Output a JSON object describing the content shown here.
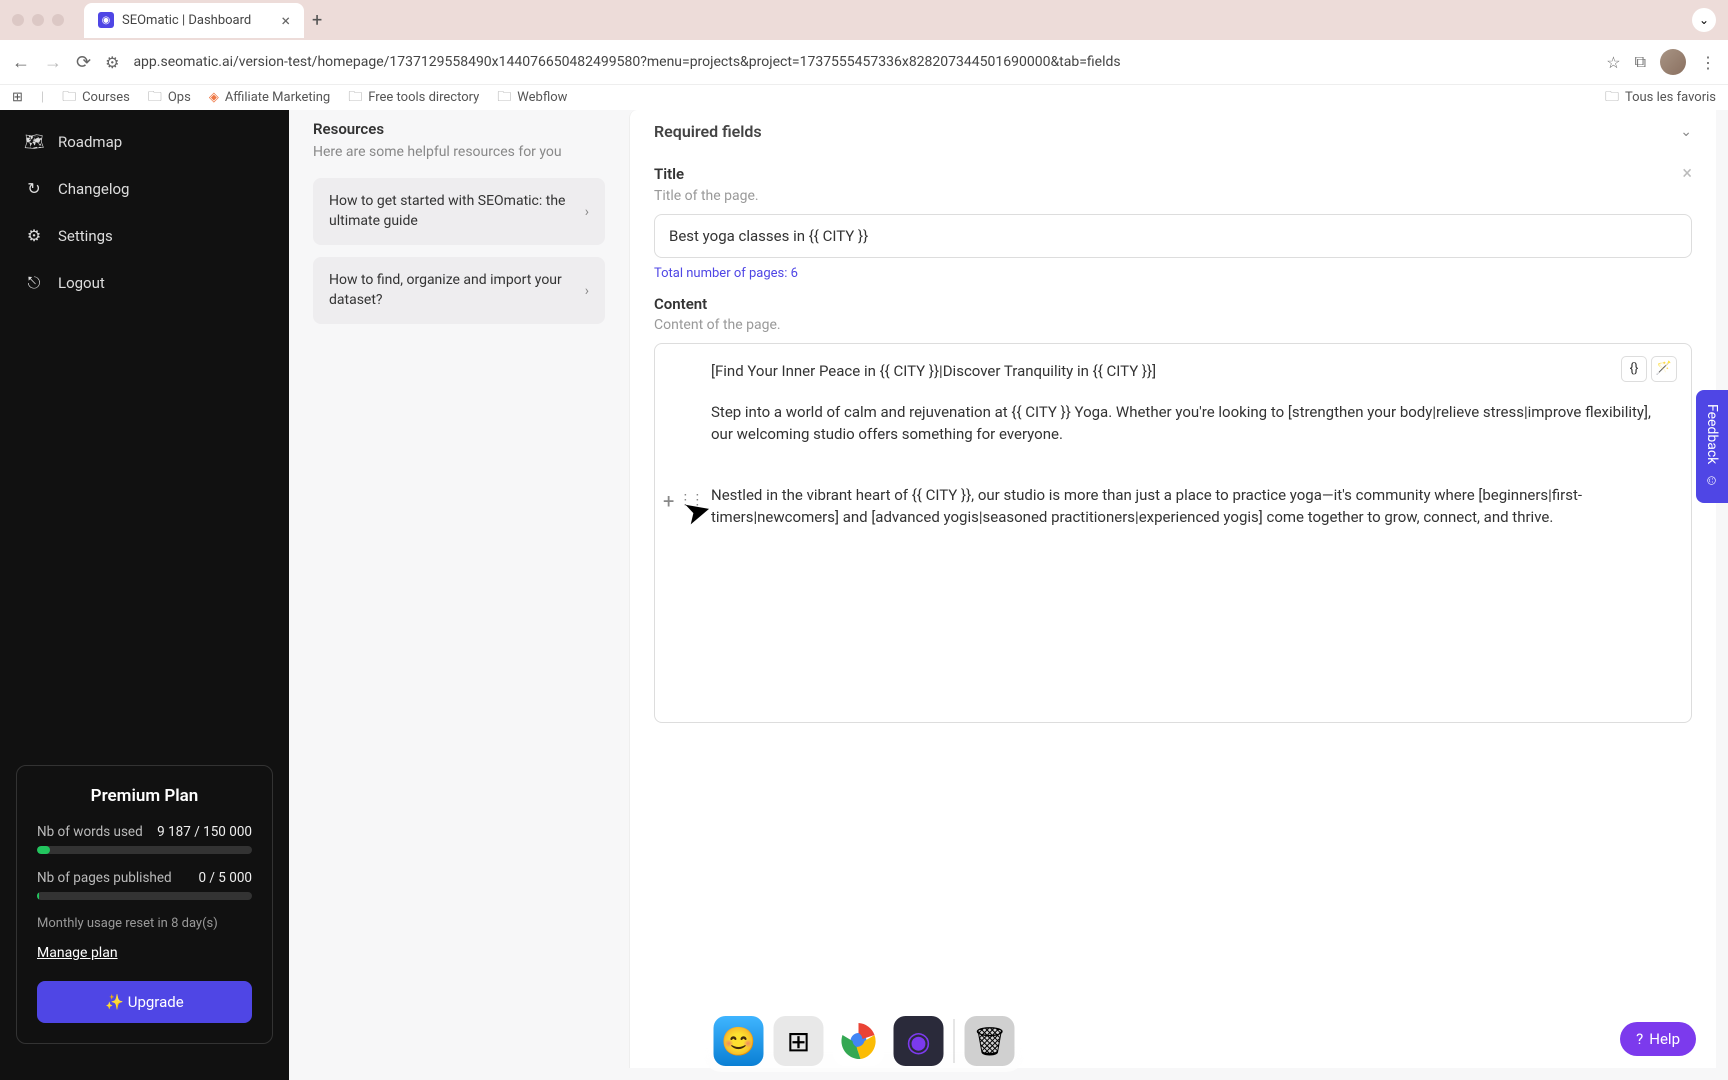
{
  "browser": {
    "tab_title": "SEOmatic | Dashboard",
    "url": "app.seomatic.ai/version-test/homepage/1737129558490x144076650482499580?menu=projects&project=1737555457336x828207344501690000&tab=fields",
    "bookmarks": [
      "Courses",
      "Ops",
      "Affiliate Marketing",
      "Free tools directory",
      "Webflow"
    ],
    "all_favorites": "Tous les favoris"
  },
  "sidebar": {
    "items": [
      {
        "icon": "🗺",
        "label": "Roadmap"
      },
      {
        "icon": "↻",
        "label": "Changelog"
      },
      {
        "icon": "⚙",
        "label": "Settings"
      },
      {
        "icon": "⎋",
        "label": "Logout"
      }
    ]
  },
  "plan": {
    "title": "Premium Plan",
    "words_label": "Nb of words used",
    "words_value": "9 187 / 150 000",
    "words_pct": 6,
    "pages_label": "Nb of pages published",
    "pages_value": "0 / 5 000",
    "pages_pct": 1,
    "reset_text": "Monthly usage reset in 8 day(s)",
    "manage_link": "Manage plan",
    "upgrade_label": "✨ Upgrade"
  },
  "resources": {
    "title": "Resources",
    "subtitle": "Here are some helpful resources for you",
    "cards": [
      "How to get started with SEOmatic: the ultimate guide",
      "How to find, organize and import your dataset?"
    ]
  },
  "fields": {
    "section_title": "Required fields",
    "title_label": "Title",
    "title_desc": "Title of the page.",
    "title_value": "Best yoga classes in {{ CITY }}",
    "pages_count": "Total number of pages: 6",
    "content_label": "Content",
    "content_desc": "Content of the page.",
    "content_p1": "[Find Your Inner Peace in {{ CITY }}|Discover Tranquility in {{ CITY }}]",
    "content_p2": "Step into a world of calm and rejuvenation at {{ CITY }} Yoga. Whether you're looking to [strengthen your body|relieve stress|improve flexibility], our welcoming studio offers something for everyone.",
    "content_p3": "Nestled in the vibrant heart of {{ CITY }}, our studio is more than just a place to practice yoga—it's community where [beginners|first-timers|newcomers] and [advanced yogis|seasoned practitioners|experienced yogis] come together to grow, connect, and thrive."
  },
  "feedback": {
    "label": "Feedback"
  },
  "help": {
    "label": "Help"
  }
}
